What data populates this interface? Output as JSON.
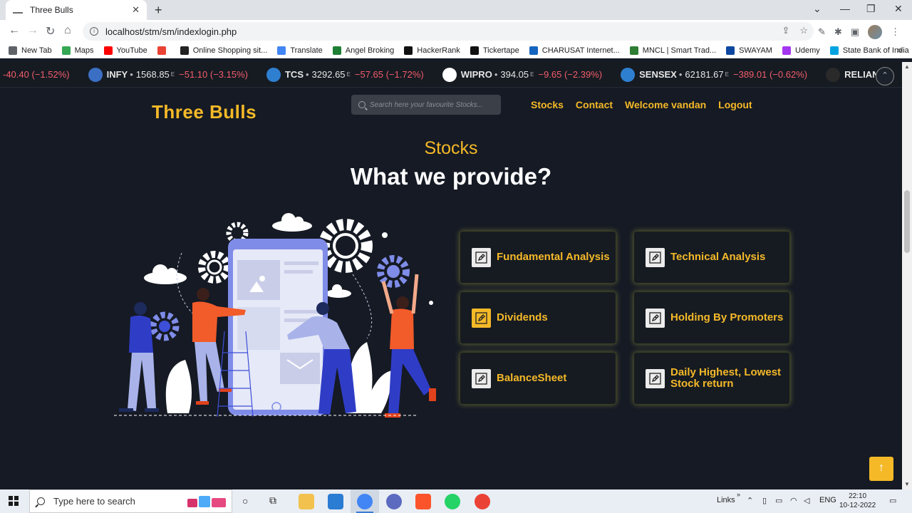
{
  "browser": {
    "tab_title": "Three Bulls",
    "tab_close": "✕",
    "new_tab": "+",
    "url": "localhost/stm/sm/indexlogin.php",
    "bookmarks": [
      {
        "label": "New Tab",
        "color": "#5f6368"
      },
      {
        "label": "Maps",
        "color": "#34a853"
      },
      {
        "label": "YouTube",
        "color": "#ff0000"
      },
      {
        "label": "",
        "color": "#ea4335"
      },
      {
        "label": "Online Shopping sit...",
        "color": "#222222"
      },
      {
        "label": "Translate",
        "color": "#4285f4"
      },
      {
        "label": "Angel Broking",
        "color": "#1e7e34"
      },
      {
        "label": "HackerRank",
        "color": "#111111"
      },
      {
        "label": "Tickertape",
        "color": "#111111"
      },
      {
        "label": "CHARUSAT Internet...",
        "color": "#1565c0"
      },
      {
        "label": "MNCL | Smart Trad...",
        "color": "#2e7d32"
      },
      {
        "label": "SWAYAM",
        "color": "#0d47a1"
      },
      {
        "label": "Udemy",
        "color": "#a435f0"
      },
      {
        "label": "State Bank of India",
        "color": "#00a3e0"
      }
    ],
    "bookmarks_more": "»"
  },
  "ticker": {
    "leading": "-40.40 (−1.52%)",
    "items": [
      {
        "symbol": "INFY",
        "price": "1568.85",
        "sup": "E",
        "change": "−51.10 (−3.15%)",
        "logo_color": "#3b6fc4",
        "logo_text": "Infosys"
      },
      {
        "symbol": "TCS",
        "price": "3292.65",
        "sup": "E",
        "change": "−57.65 (−1.72%)",
        "logo_color": "#2f7fd0",
        "logo_text": "tcs"
      },
      {
        "symbol": "WIPRO",
        "price": "394.05",
        "sup": "E",
        "change": "−9.65 (−2.39%)",
        "logo_color": "#ffffff",
        "logo_text": "W"
      },
      {
        "symbol": "SENSEX",
        "price": "62181.67",
        "sup": "E",
        "change": "−389.01 (−0.62%)",
        "logo_color": "#2f7fd0",
        "logo_text": "BSE"
      },
      {
        "symbol": "RELIANCE",
        "price": "",
        "sup": "",
        "change": "",
        "logo_color": "#2a2a2a",
        "logo_text": "R"
      }
    ]
  },
  "site": {
    "brand": "Three Bulls",
    "search_placeholder": "Search here your favourite Stocks...",
    "nav": {
      "stocks": "Stocks",
      "contact": "Contact",
      "welcome": "Welcome vandan",
      "logout": "Logout"
    },
    "subtitle": "Stocks",
    "heading": "What we provide?",
    "features": [
      {
        "label": "Fundamental Analysis",
        "icon": "pen-icon",
        "highlight": false
      },
      {
        "label": "Technical Analysis",
        "icon": "pen-icon",
        "highlight": false
      },
      {
        "label": "Dividends",
        "icon": "pen-icon",
        "highlight": true
      },
      {
        "label": "Holding By Promoters",
        "icon": "pen-icon",
        "highlight": false
      },
      {
        "label": "BalanceSheet",
        "icon": "pen-icon",
        "highlight": false
      },
      {
        "label": "Daily Highest, Lowest Stock return",
        "icon": "pen-icon",
        "highlight": false
      }
    ],
    "to_top": "↑",
    "accent_color": "#f5b928"
  },
  "taskbar": {
    "search_placeholder": "Type here to search",
    "links": "Links",
    "lang": "ENG",
    "time": "22:10",
    "date": "10-12-2022"
  }
}
